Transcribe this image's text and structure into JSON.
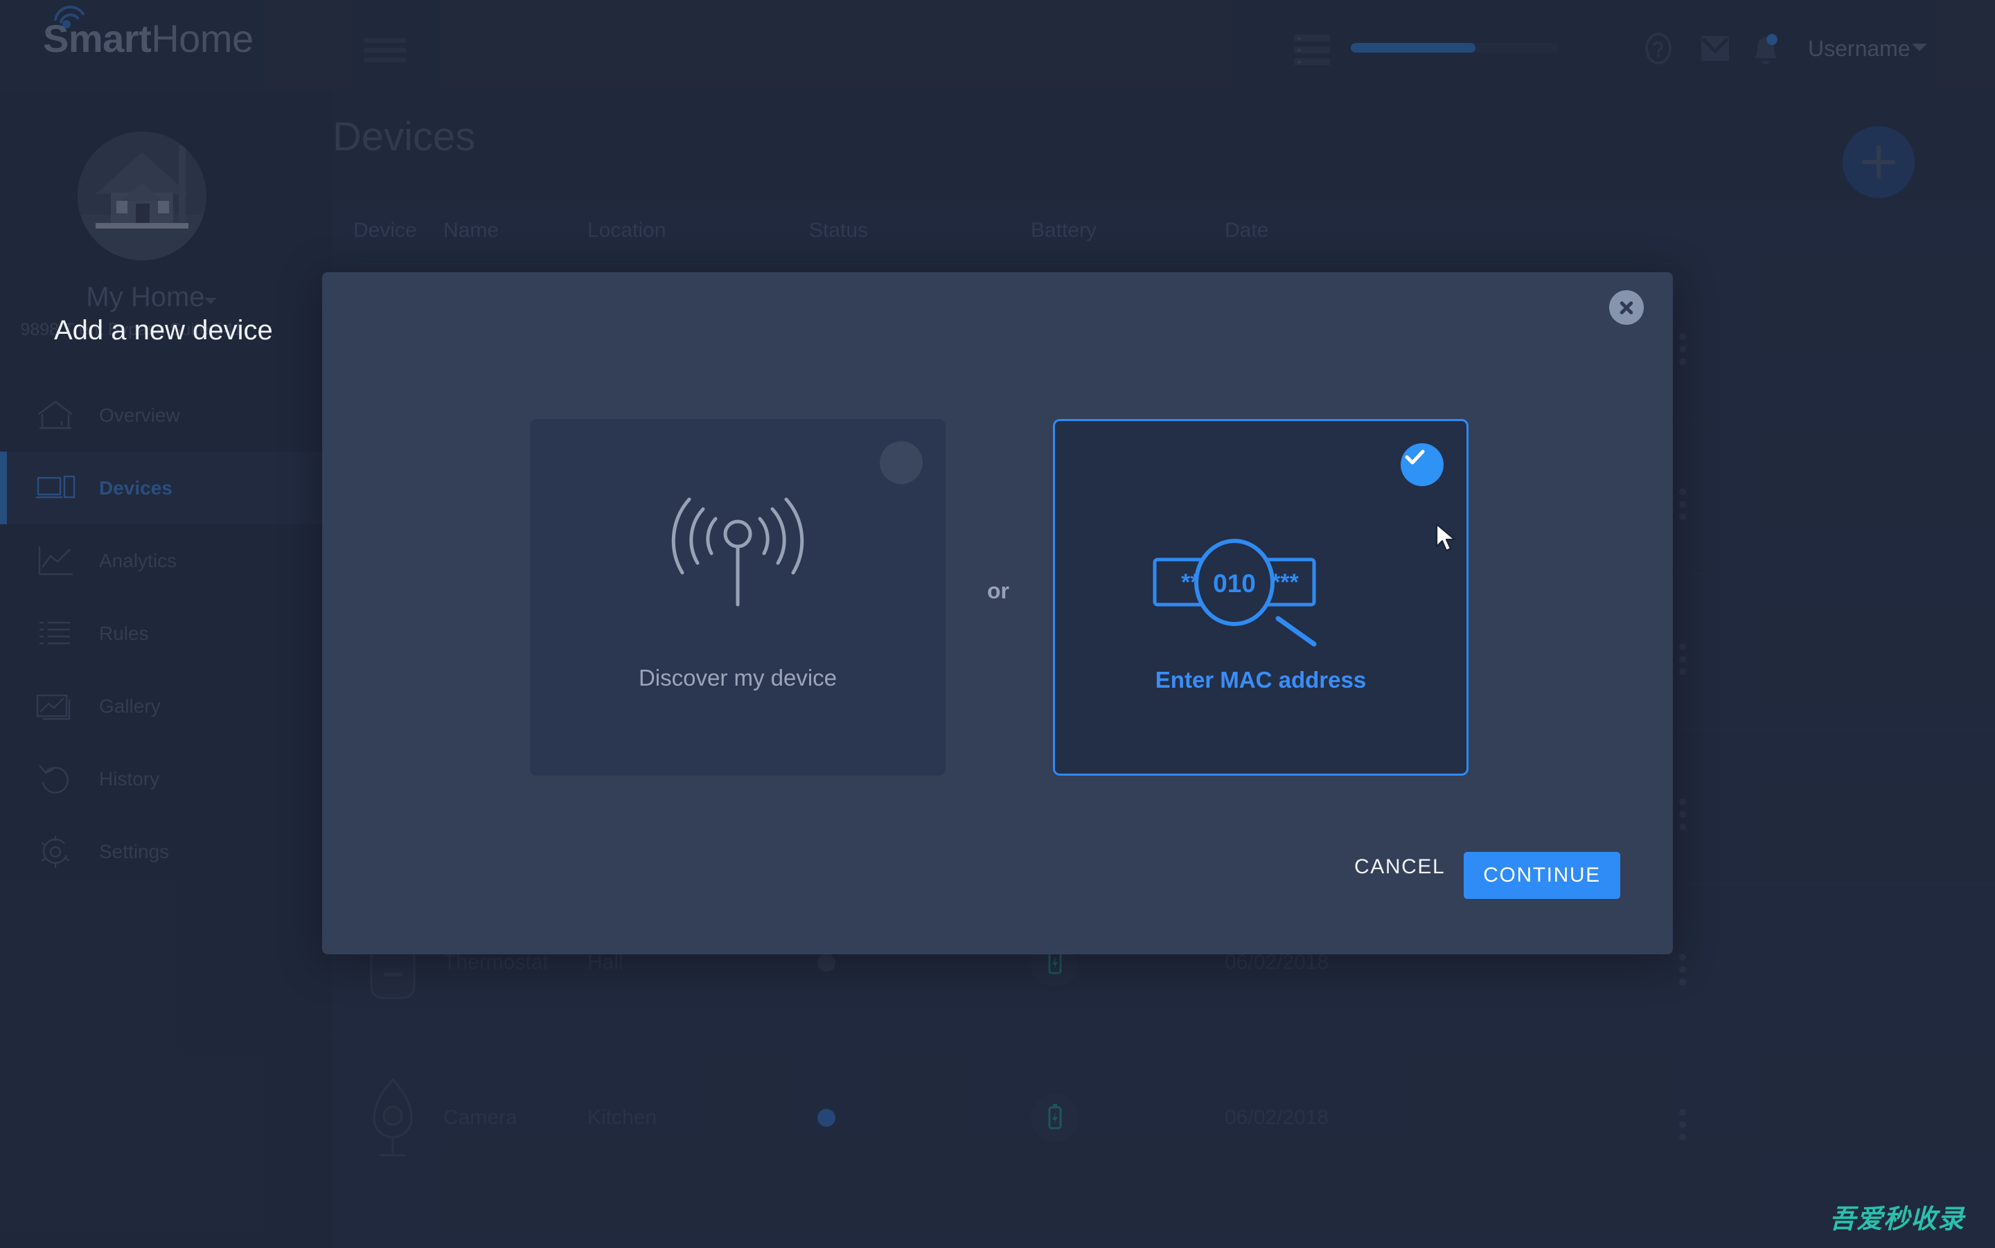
{
  "app": {
    "logo_bold": "Smart",
    "logo_light": "Home",
    "accent_color": "#2f8bf5",
    "bg_color": "#252e42",
    "sidebar_color": "#232c40"
  },
  "header": {
    "menu_icon": "hamburger-icon",
    "server_icon": "server-stack-icon",
    "progress_percent": 60,
    "help_icon": "help-circle-icon",
    "mail_icon": "mail-envelope-icon",
    "bell_icon": "notification-bell-icon",
    "username": "Username",
    "caret_icon": "chevron-down-icon"
  },
  "sidebar": {
    "avatar_icon": "house-photo-avatar",
    "home_name": "My Home",
    "home_address": "9898 Trent Bypass Suite 541",
    "items": [
      {
        "label": "Overview",
        "icon": "home-icon",
        "active": false
      },
      {
        "label": "Devices",
        "icon": "devices-icon",
        "active": true
      },
      {
        "label": "Analytics",
        "icon": "chart-line-icon",
        "active": false
      },
      {
        "label": "Rules",
        "icon": "list-icon",
        "active": false
      },
      {
        "label": "Gallery",
        "icon": "image-gallery-icon",
        "active": false
      },
      {
        "label": "History",
        "icon": "undo-history-icon",
        "active": false
      },
      {
        "label": "Settings",
        "icon": "gear-icon",
        "active": false
      }
    ]
  },
  "main": {
    "page_title": "Devices",
    "add_button_icon": "plus-icon",
    "table": {
      "columns": [
        "Device",
        "Name",
        "Location",
        "Status",
        "Battery",
        "Date"
      ],
      "rows": [
        {
          "name": "",
          "location": "",
          "status": "",
          "battery": "",
          "date": "",
          "icon": ""
        },
        {
          "name": "",
          "location": "",
          "status": "",
          "battery": "",
          "date": "",
          "icon": ""
        },
        {
          "name": "",
          "location": "",
          "status": "",
          "battery": "",
          "date": "",
          "icon": ""
        },
        {
          "name": "",
          "location": "",
          "status": "",
          "battery": "",
          "date": "",
          "icon": ""
        },
        {
          "name": "Thermostat",
          "location": "Hall",
          "status": "offline",
          "status_color": "#3d465c",
          "battery": "charging",
          "date": "06/02/2018",
          "icon": "thermostat-icon"
        },
        {
          "name": "Camera",
          "location": "Kitchen",
          "status": "online",
          "status_color": "#2f6fc4",
          "battery": "charging",
          "date": "06/02/2018",
          "icon": "camera-icon"
        }
      ],
      "row_menu_icon": "kebab-menu-icon"
    }
  },
  "modal": {
    "title": "Add a new device",
    "close_icon": "close-icon",
    "separator": "or",
    "options": [
      {
        "label": "Discover my device",
        "icon": "broadcast-signal-icon",
        "badge_icon": "radio-unchecked",
        "selected": false
      },
      {
        "label": "Enter MAC address",
        "icon": "magnifier-mac-icon",
        "badge_icon": "check-icon",
        "selected": true,
        "mac_left": "***",
        "mac_center": "010",
        "mac_right": "***"
      }
    ],
    "cancel_label": "CANCEL",
    "continue_label": "CONTINUE"
  },
  "watermark": "吾爱秒收录"
}
